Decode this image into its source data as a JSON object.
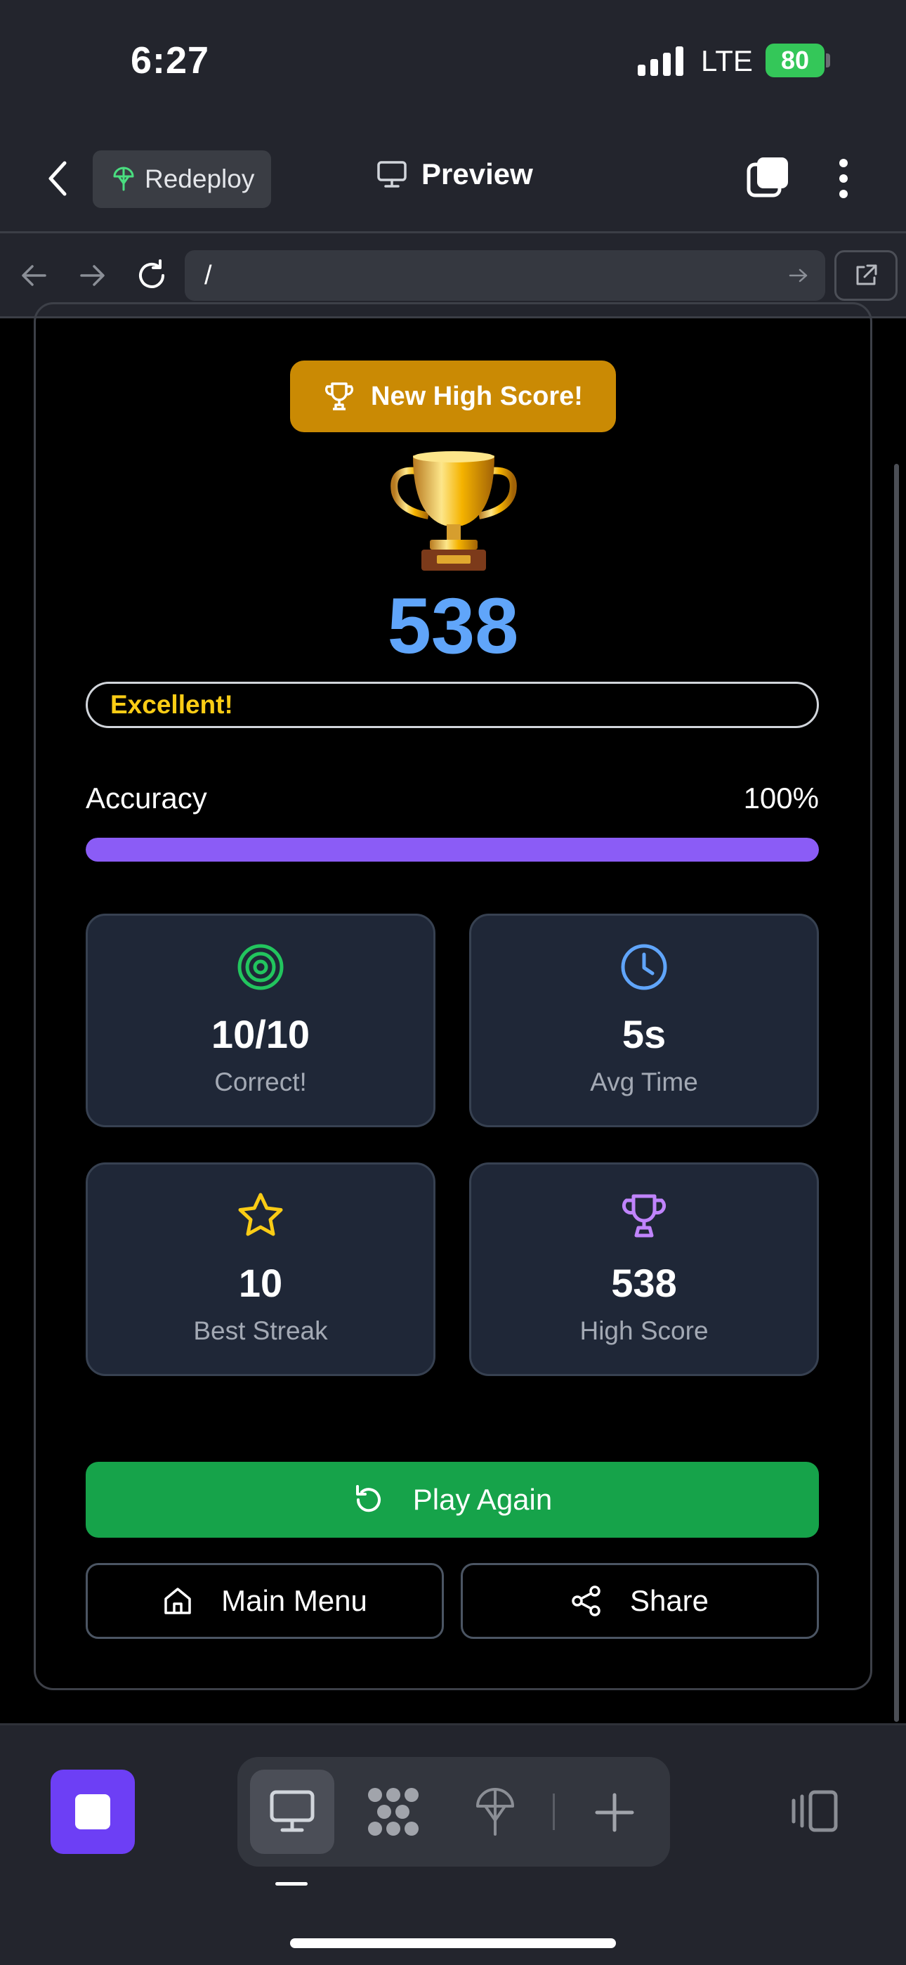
{
  "status_bar": {
    "time": "6:27",
    "network": "LTE",
    "battery": "80"
  },
  "top_bar": {
    "redeploy_label": "Redeploy",
    "preview_label": "Preview"
  },
  "url_bar": {
    "value": "/"
  },
  "results": {
    "badge": "New High Score!",
    "score": "538",
    "rating": "Excellent!",
    "accuracy_label": "Accuracy",
    "accuracy_value": "100%",
    "accuracy_fraction": 1.0,
    "stats": [
      {
        "icon": "target-icon",
        "value": "10/10",
        "label": "Correct!",
        "color": "#22c55e"
      },
      {
        "icon": "clock-icon",
        "value": "5s",
        "label": "Avg Time",
        "color": "#60a5fa"
      },
      {
        "icon": "star-icon",
        "value": "10",
        "label": "Best Streak",
        "color": "#facc15"
      },
      {
        "icon": "trophy-icon",
        "value": "538",
        "label": "High Score",
        "color": "#c084fc"
      }
    ],
    "play_again": "Play Again",
    "main_menu": "Main Menu",
    "share": "Share"
  },
  "colors": {
    "accent_purple": "#8b5cf6",
    "play_green": "#16a34a",
    "badge_gold": "#ca8a04",
    "score_blue": "#60a5fa"
  }
}
